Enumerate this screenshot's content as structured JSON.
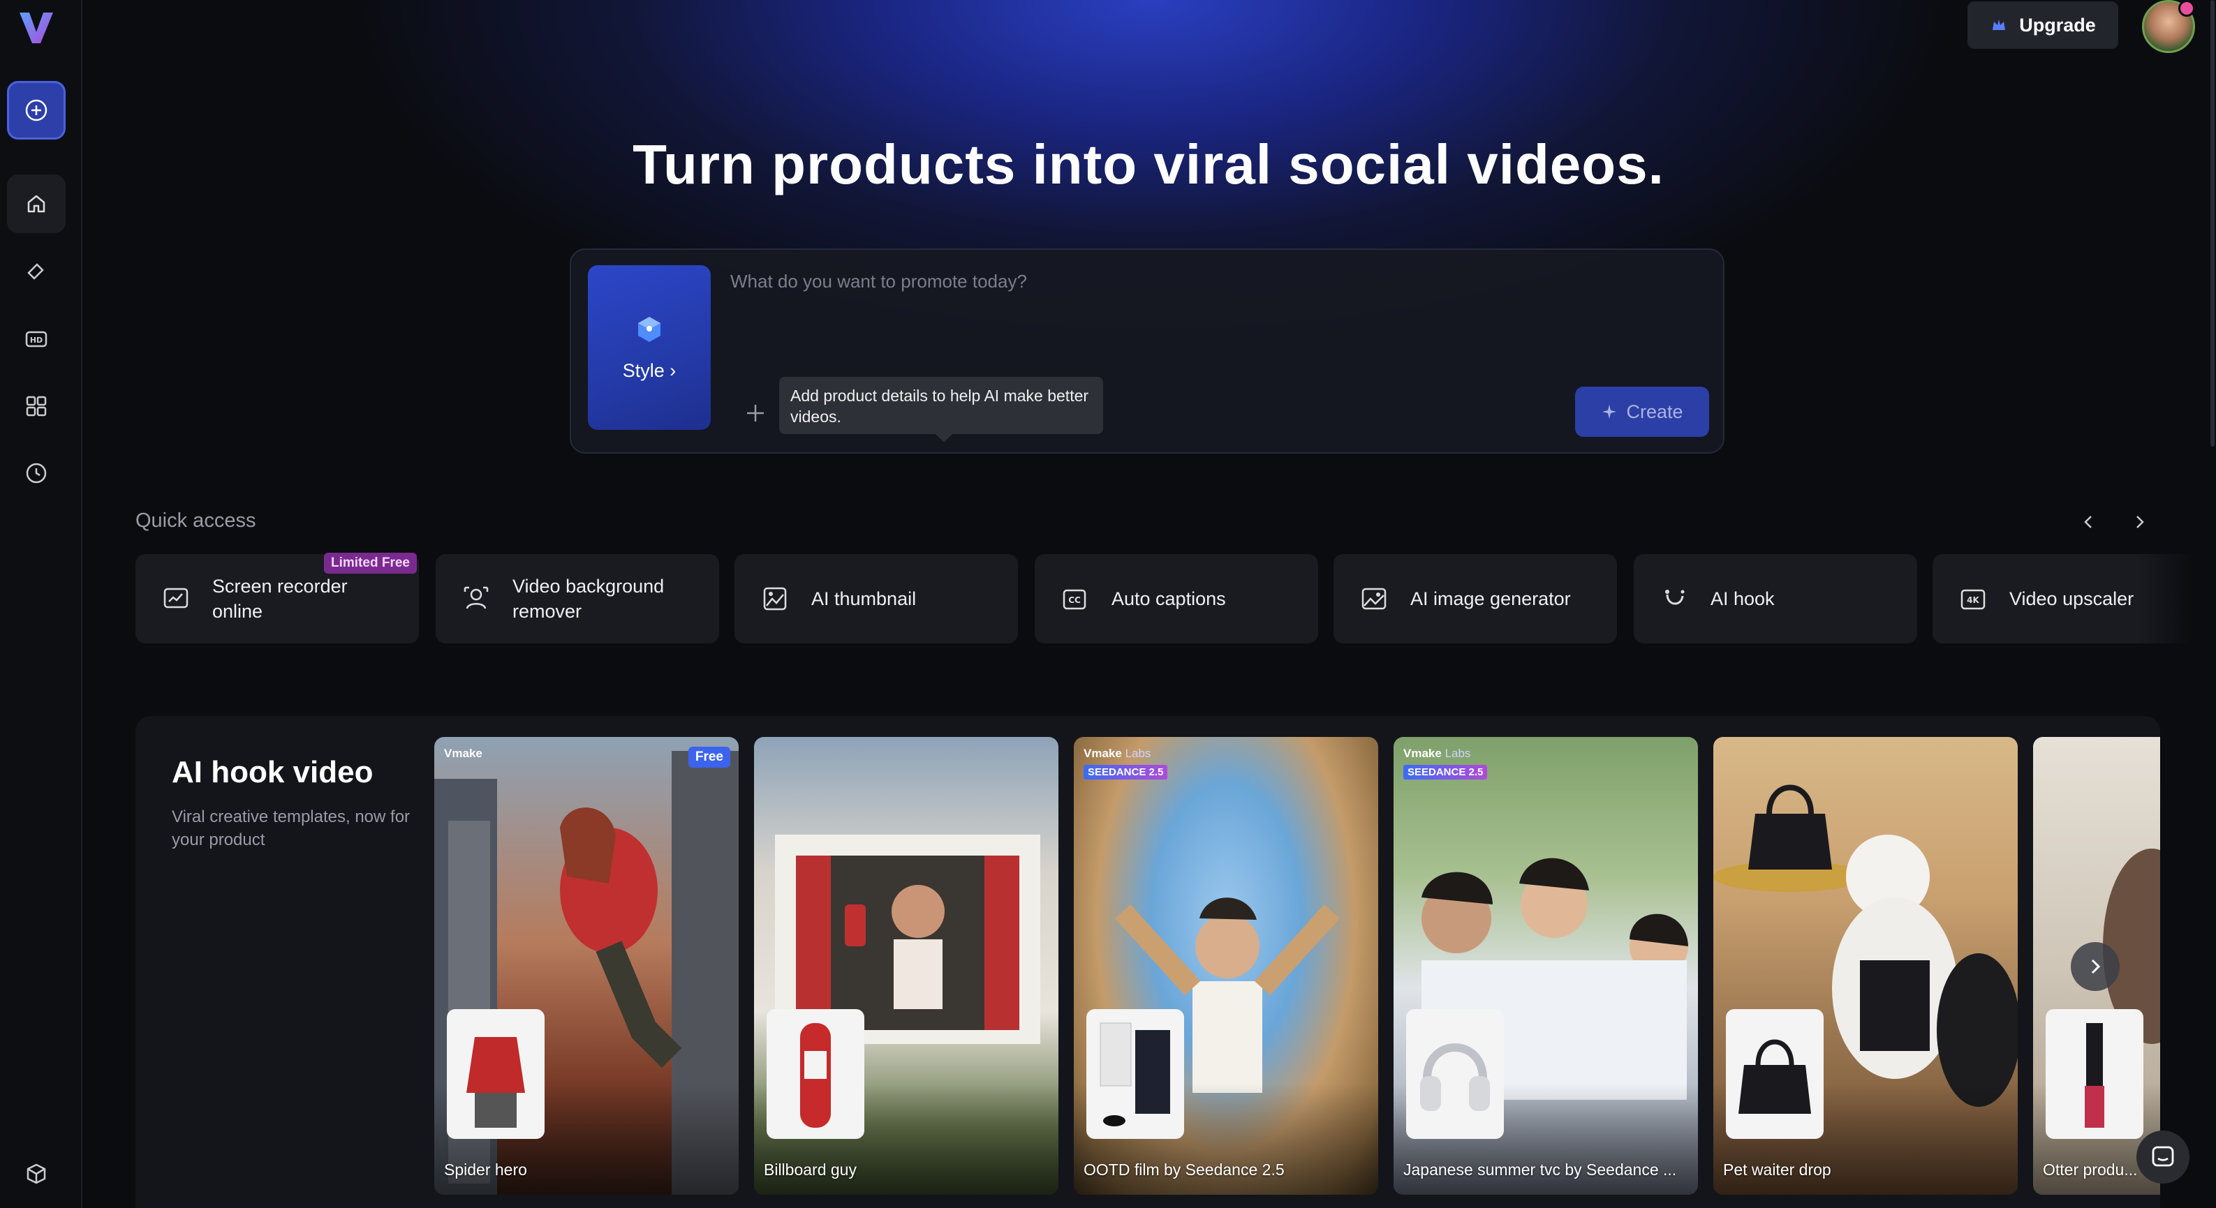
{
  "header": {
    "upgrade_label": "Upgrade"
  },
  "sidebar": {
    "items": [
      "new-project",
      "home",
      "eraser",
      "hd",
      "apps",
      "history",
      "box"
    ]
  },
  "hero": {
    "title": "Turn products into viral social videos."
  },
  "prompt": {
    "placeholder": "What do you want to promote today?",
    "style_label": "Style",
    "tooltip": "Add product details to help AI make better videos.",
    "create_label": "Create"
  },
  "quick_access": {
    "title": "Quick access",
    "badge": "Limited Free",
    "items": [
      {
        "label_1": "Screen recorder",
        "label_2": "online",
        "icon": "screen-recorder-icon"
      },
      {
        "label_1": "Video background",
        "label_2": "remover",
        "icon": "background-remover-icon"
      },
      {
        "label_1": "AI thumbnail",
        "label_2": "",
        "icon": "thumbnail-icon"
      },
      {
        "label_1": "Auto captions",
        "label_2": "",
        "icon": "captions-icon"
      },
      {
        "label_1": "AI image generator",
        "label_2": "",
        "icon": "image-generator-icon"
      },
      {
        "label_1": "AI hook",
        "label_2": "",
        "icon": "hook-icon"
      },
      {
        "label_1": "Video upscaler",
        "label_2": "",
        "icon": "upscaler-icon"
      }
    ]
  },
  "hook": {
    "title": "AI hook video",
    "subtitle": "Viral creative templates, now for your product",
    "free_tag": "Free",
    "brand": "Vmake",
    "brand_lab": "Labs",
    "seed_tag": "SEEDANCE 2.5",
    "cards": [
      {
        "caption": "Spider hero"
      },
      {
        "caption": "Billboard guy"
      },
      {
        "caption": "OOTD film by Seedance 2.5"
      },
      {
        "caption": "Japanese summer tvc by Seedance ..."
      },
      {
        "caption": "Pet waiter drop"
      },
      {
        "caption": "Otter produ..."
      }
    ]
  },
  "colors": {
    "accent": "#2c46c8",
    "background": "#0b0c10",
    "badge": "#7a2a8e"
  }
}
